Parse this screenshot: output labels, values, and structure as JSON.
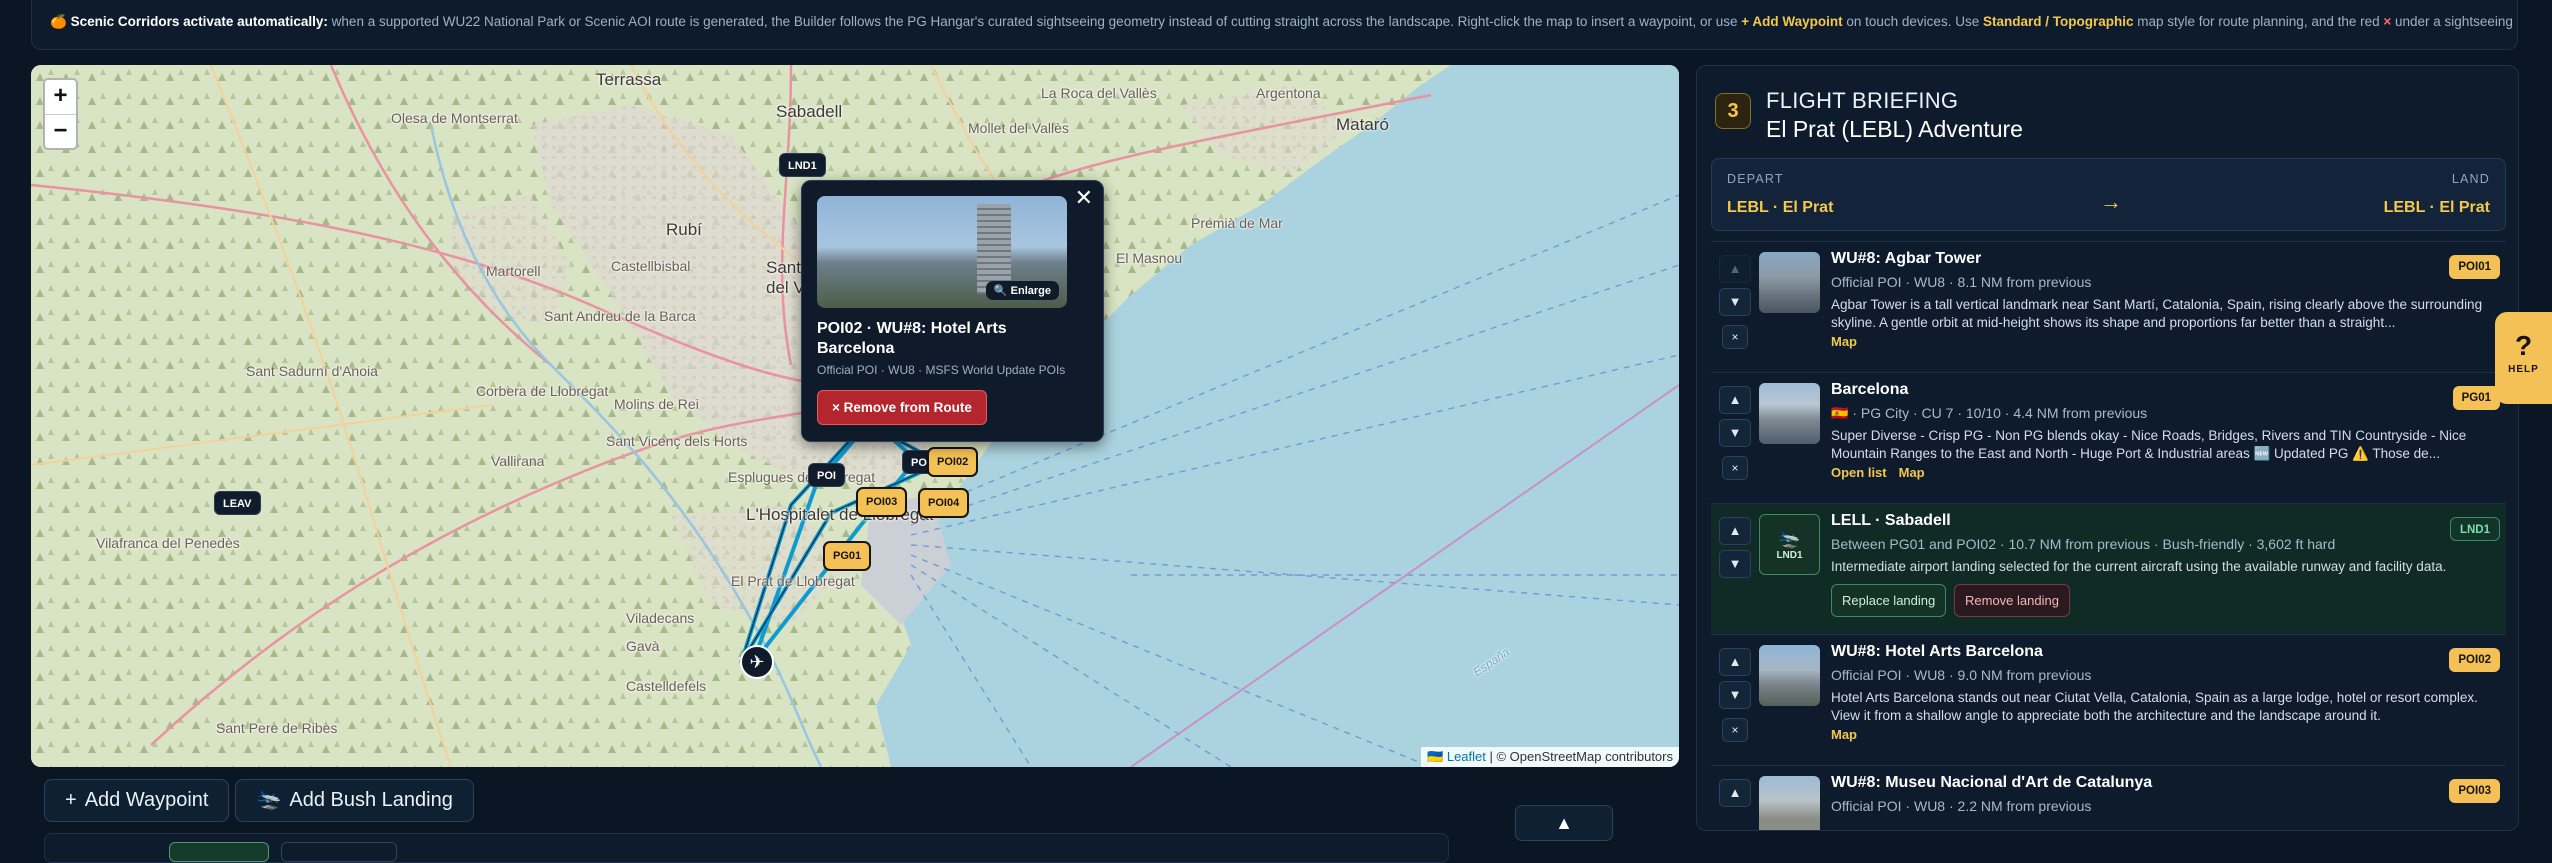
{
  "notice": {
    "emoji": "🍊",
    "lead": "Scenic Corridors activate automatically:",
    "text1": " when a supported WU22 National Park or Scenic AOI route is generated, the Builder follows the PG Hangar's curated sightseeing geometry instead of cutting straight across the landscape. Right-click the map to insert a waypoint, or use ",
    "add_wp": "+ Add Waypoint",
    "text2": " on touch devices. Use ",
    "style": "Standard / Topographic",
    "text3": " map style for route planning, and the red ",
    "x": "×",
    "text4": " under a sightseeing point to remove it safely after confirmation."
  },
  "map": {
    "zoom_in": "+",
    "zoom_out": "−",
    "attribution_flag": "🇺🇦",
    "attribution_leaflet": "Leaflet",
    "attribution_rest": " | © OpenStreetMap contributors",
    "places": {
      "terrassa": "Terrassa",
      "sabadell": "Sabadell",
      "mataro": "Mataró",
      "olesa": "Olesa de Montserrat",
      "argentona": "Argentona",
      "mollet": "Mollet del Vallès",
      "granollers": "La Roca del Vallès",
      "rubi": "Rubí",
      "martorell": "Martorell",
      "castellbisbal": "Castellbisbal",
      "premia": "Premià de Mar",
      "sant_cugat": "Sant Cug",
      "del_valles": "del Vallès",
      "el_masnou": "El Masnou",
      "sant_andreu": "Sant Andreu de la Barca",
      "sant_sadurni": "Sant Sadurní d'Anoia",
      "corbera": "Corbera de Llobregat",
      "molins": "Molins de Rei",
      "vallirana": "Vallirana",
      "sant_vicenc": "Sant Vicenç dels Horts",
      "esplugues": "Esplugues de Llobregat",
      "hospitalet": "L'Hospitalet de Llobregat",
      "el_prat": "El Prat de Llobregat",
      "vilafranca": "Vilafranca del Penedès",
      "viladecans": "Viladecans",
      "gava": "Gavà",
      "castelldefels": "Castelldefels",
      "sant_pere": "Sant Pere de Ribes",
      "espana": "España"
    },
    "pins": {
      "lnd1": "LND1",
      "leav": "LEAV",
      "poi": "POI",
      "po": "PO",
      "poi02": "POI02",
      "poi03": "POI03",
      "poi04": "POI04",
      "pg01": "PG01"
    },
    "plane_glyph": "✈",
    "popup": {
      "close": "✕",
      "enlarge": "🔍 Enlarge",
      "title": "POI02 · WU#8: Hotel Arts Barcelona",
      "meta": "Official POI · WU8 · MSFS World Update POIs",
      "remove": "× Remove from Route"
    }
  },
  "controls": {
    "add_waypoint": "Add Waypoint",
    "add_waypoint_icon": "+",
    "add_bush": "Add Bush Landing",
    "add_bush_icon": "🛬",
    "collapse": "▲"
  },
  "panel": {
    "step": "3",
    "kicker": "FLIGHT BRIEFING",
    "title": "El Prat (LEBL) Adventure",
    "depart_label": "DEPART",
    "depart_value": "LEBL · El Prat",
    "land_label": "LAND",
    "land_value": "LEBL · El Prat",
    "arrow": "→",
    "items": [
      {
        "name": "WU#8: Agbar Tower",
        "meta": "Official POI · WU8 · 8.1 NM from previous",
        "desc": "Agbar Tower is a tall vertical landmark near Sant Martí, Catalonia, Spain, rising clearly above the surrounding skyline. A gentle orbit at mid-height shows its shape and proportions far better than a straight...",
        "link1": "Map",
        "badge": "POI01"
      },
      {
        "name": "Barcelona",
        "meta": "🇪🇸 · PG City · CU 7 · 10/10 · 4.4 NM from previous",
        "desc": "Super Diverse - Crisp PG - Non PG blends okay - Nice Roads, Bridges, Rivers and TIN Countryside - Nice Mountain Ranges to the East and North - Huge Port & Industrial areas 🆕 Updated PG ⚠️ Those de...",
        "link1": "Open list",
        "link2": "Map",
        "badge": "PG01"
      },
      {
        "name": "LELL · Sabadell",
        "meta": "Between PG01 and POI02 · 10.7 NM from previous · Bush-friendly · 3,602 ft hard",
        "desc": "Intermediate airport landing selected for the current aircraft using the available runway and facility data.",
        "replace": "Replace landing",
        "remove": "Remove landing",
        "badge": "LND1",
        "thumb_label": "LND1"
      },
      {
        "name": "WU#8: Hotel Arts Barcelona",
        "meta": "Official POI · WU8 · 9.0 NM from previous",
        "desc": "Hotel Arts Barcelona stands out near Ciutat Vella, Catalonia, Spain as a large lodge, hotel or resort complex. View it from a shallow angle to appreciate both the architecture and the landscape around it.",
        "link1": "Map",
        "badge": "POI02"
      },
      {
        "name": "WU#8: Museu Nacional d'Art de Catalunya",
        "meta": "Official POI · WU8 · 2.2 NM from previous",
        "badge": "POI03"
      }
    ],
    "up": "▲",
    "down": "▼",
    "remove_x": "×"
  },
  "help": {
    "q": "?",
    "label": "HELP"
  },
  "colors": {
    "accent": "#f3c155",
    "danger": "#b3262e",
    "panel_bg": "#0e1b2c",
    "route": "#0e9bd0"
  }
}
